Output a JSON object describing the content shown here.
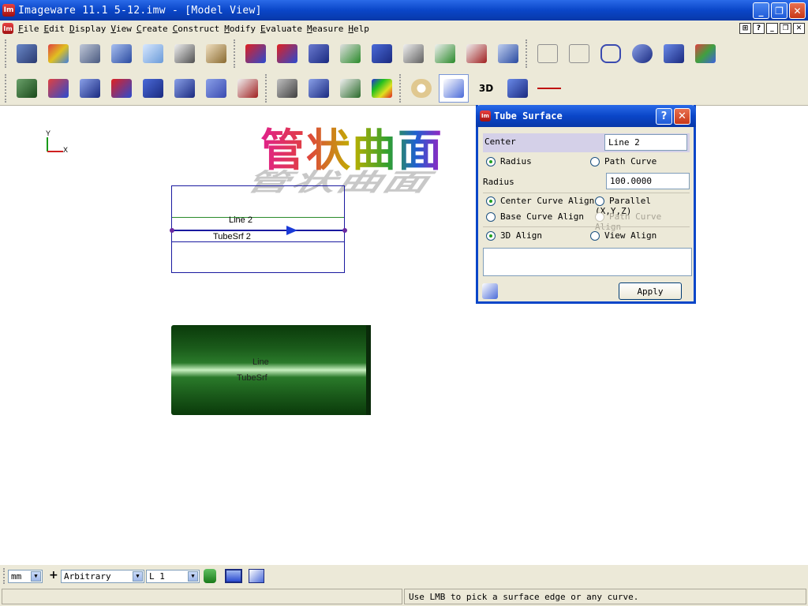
{
  "window": {
    "app_icon": "Im",
    "title": "Imageware 11.1    5-12.imw - [Model View]",
    "min": "_",
    "restore": "❐",
    "close": "✕"
  },
  "menu": {
    "app_icon": "Im",
    "items": [
      "File",
      "Edit",
      "Display",
      "View",
      "Create",
      "Construct",
      "Modify",
      "Evaluate",
      "Measure",
      "Help"
    ]
  },
  "mdi_buttons": [
    "⊞",
    "?",
    "_",
    "❐",
    "✕"
  ],
  "toolbar1": {
    "icons": [
      "open-folder-icon",
      "import-icon",
      "inspect-icon",
      "surface-edit-icon",
      "cube-icon",
      "point-cloud-icon",
      "mesh-cup-icon",
      "surface-blue-icon",
      "surface-diamond-icon",
      "surface-sweep-icon",
      "surface-loft-icon",
      "surface-boundary-icon",
      "surface-offset-icon",
      "surface-extend-icon",
      "surface-cone-icon",
      "wire-box-icon",
      "wire-frame-icon",
      "network-icon",
      "capsule-icon",
      "plane-icon",
      "axes-icon"
    ]
  },
  "toolbar2": {
    "icons": [
      "surface-green-icon",
      "trim-icon",
      "stack-icon",
      "normal-arrow-icon",
      "frame-icon",
      "grid-surface-icon",
      "pen-tool-icon",
      "section-icon",
      "fillet-icon",
      "layer-icon",
      "slab-icon",
      "color-gradient-icon",
      "palette-icon",
      "curve-wave-icon",
      "3d-label-icon",
      "surface-flag-icon",
      "line-segment-icon"
    ],
    "text_3d": "3D"
  },
  "viewport": {
    "axis": {
      "y": "Y",
      "x": "X"
    },
    "heading": "管状曲面",
    "wire_labels": {
      "line": "Line 2",
      "surface": "TubeSrf 2"
    },
    "tube_labels": {
      "line": "Line",
      "surface": "TubeSrf"
    }
  },
  "dialog": {
    "app_icon": "Im",
    "title": "Tube Surface",
    "help": "?",
    "close": "✕",
    "center_label": "Center",
    "center_value": "Line 2",
    "radius_option": "Radius",
    "path_curve_option": "Path Curve",
    "radius_label": "Radius",
    "radius_value": "100.0000",
    "center_curve_align": "Center Curve Align",
    "parallel": "Parallel (X,Y,Z)",
    "base_curve_align": "Base Curve Align",
    "path_curve_align": "Path Curve Align",
    "align_3d": "3D Align",
    "view_align": "View Align",
    "apply": "Apply"
  },
  "statusbar": {
    "units": "mm",
    "plus": "+",
    "mode": "Arbitrary",
    "layer": "L 1",
    "message": "Use LMB to pick a surface edge or any curve."
  },
  "colors": {
    "title_blue": "#0a46c8",
    "tube_green": "#1a5a1a",
    "wire_blue": "#1a1aa0",
    "wire_green": "#2a8a2a"
  }
}
